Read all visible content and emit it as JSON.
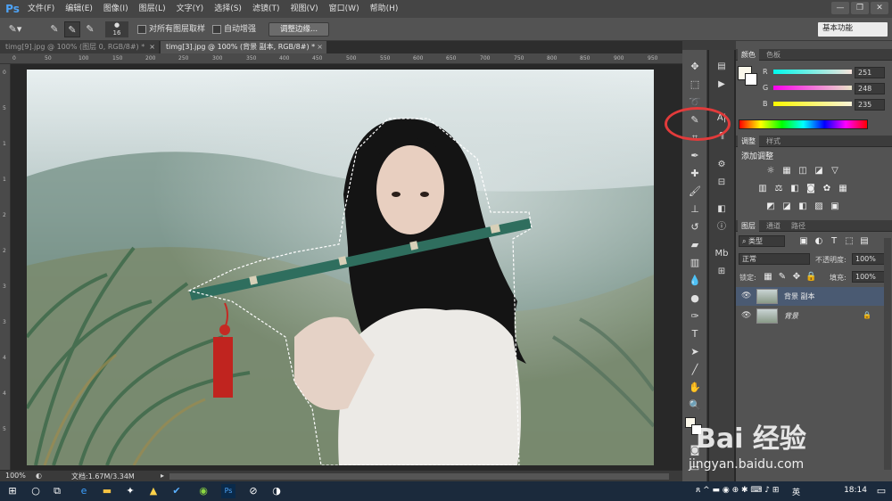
{
  "menubar": {
    "logo": "Ps",
    "items": [
      "文件(F)",
      "编辑(E)",
      "图像(I)",
      "图层(L)",
      "文字(Y)",
      "选择(S)",
      "滤镜(T)",
      "视图(V)",
      "窗口(W)",
      "帮助(H)"
    ],
    "window_controls": [
      "—",
      "❐",
      "✕"
    ]
  },
  "options": {
    "brush_size": "16",
    "sample_all_layers": "对所有图层取样",
    "auto_enhance": "自动增强",
    "refine_edge": "调整边缘...",
    "workspace": "基本功能"
  },
  "tabs": [
    {
      "label": "timg[9].jpg @ 100% (图层 0, RGB/8#) *"
    },
    {
      "label": "timg[3].jpg @ 100% (背景 副本, RGB/8#) *"
    }
  ],
  "ruler": {
    "top_ticks": [
      "0",
      "50",
      "100",
      "150",
      "200",
      "250",
      "300",
      "350",
      "400",
      "450",
      "500",
      "550",
      "600",
      "650",
      "700",
      "750",
      "800",
      "850",
      "900",
      "950"
    ],
    "left_ticks": [
      "0",
      "5",
      "1",
      "1",
      "2",
      "2",
      "3",
      "3",
      "4",
      "4",
      "5"
    ]
  },
  "status": {
    "zoom": "100%",
    "doc": "文档:1.67M/3.34M"
  },
  "color_panel": {
    "tabs": [
      "颜色",
      "色板"
    ],
    "r_label": "R",
    "g_label": "G",
    "b_label": "B",
    "r": "251",
    "g": "248",
    "b": "235",
    "colors": {
      "r_track": "#f7e4dc",
      "g_track": "#e9e4c7",
      "b_track": "#fbf4d8"
    }
  },
  "adjust_panel": {
    "tabs": [
      "调整",
      "样式"
    ],
    "title": "添加调整"
  },
  "layers_panel": {
    "tabs": [
      "图层",
      "通道",
      "路径"
    ],
    "filter": "类型",
    "blend_mode": "正常",
    "opacity_label": "不透明度:",
    "opacity": "100%",
    "lock_label": "锁定:",
    "fill_label": "填充:",
    "fill": "100%",
    "layers": [
      {
        "name": "背景 副本",
        "selected": true
      },
      {
        "name": "背景",
        "selected": false
      }
    ]
  },
  "taskbar": {
    "time": "18:14",
    "ime": "英",
    "right_icons": "ጸ ^ ▬ ◉ ⊕ ✱ ⌨ ♪ ⊞"
  },
  "watermark": {
    "brand": "Bai 经验",
    "url": "jingyan.baidu.com"
  }
}
